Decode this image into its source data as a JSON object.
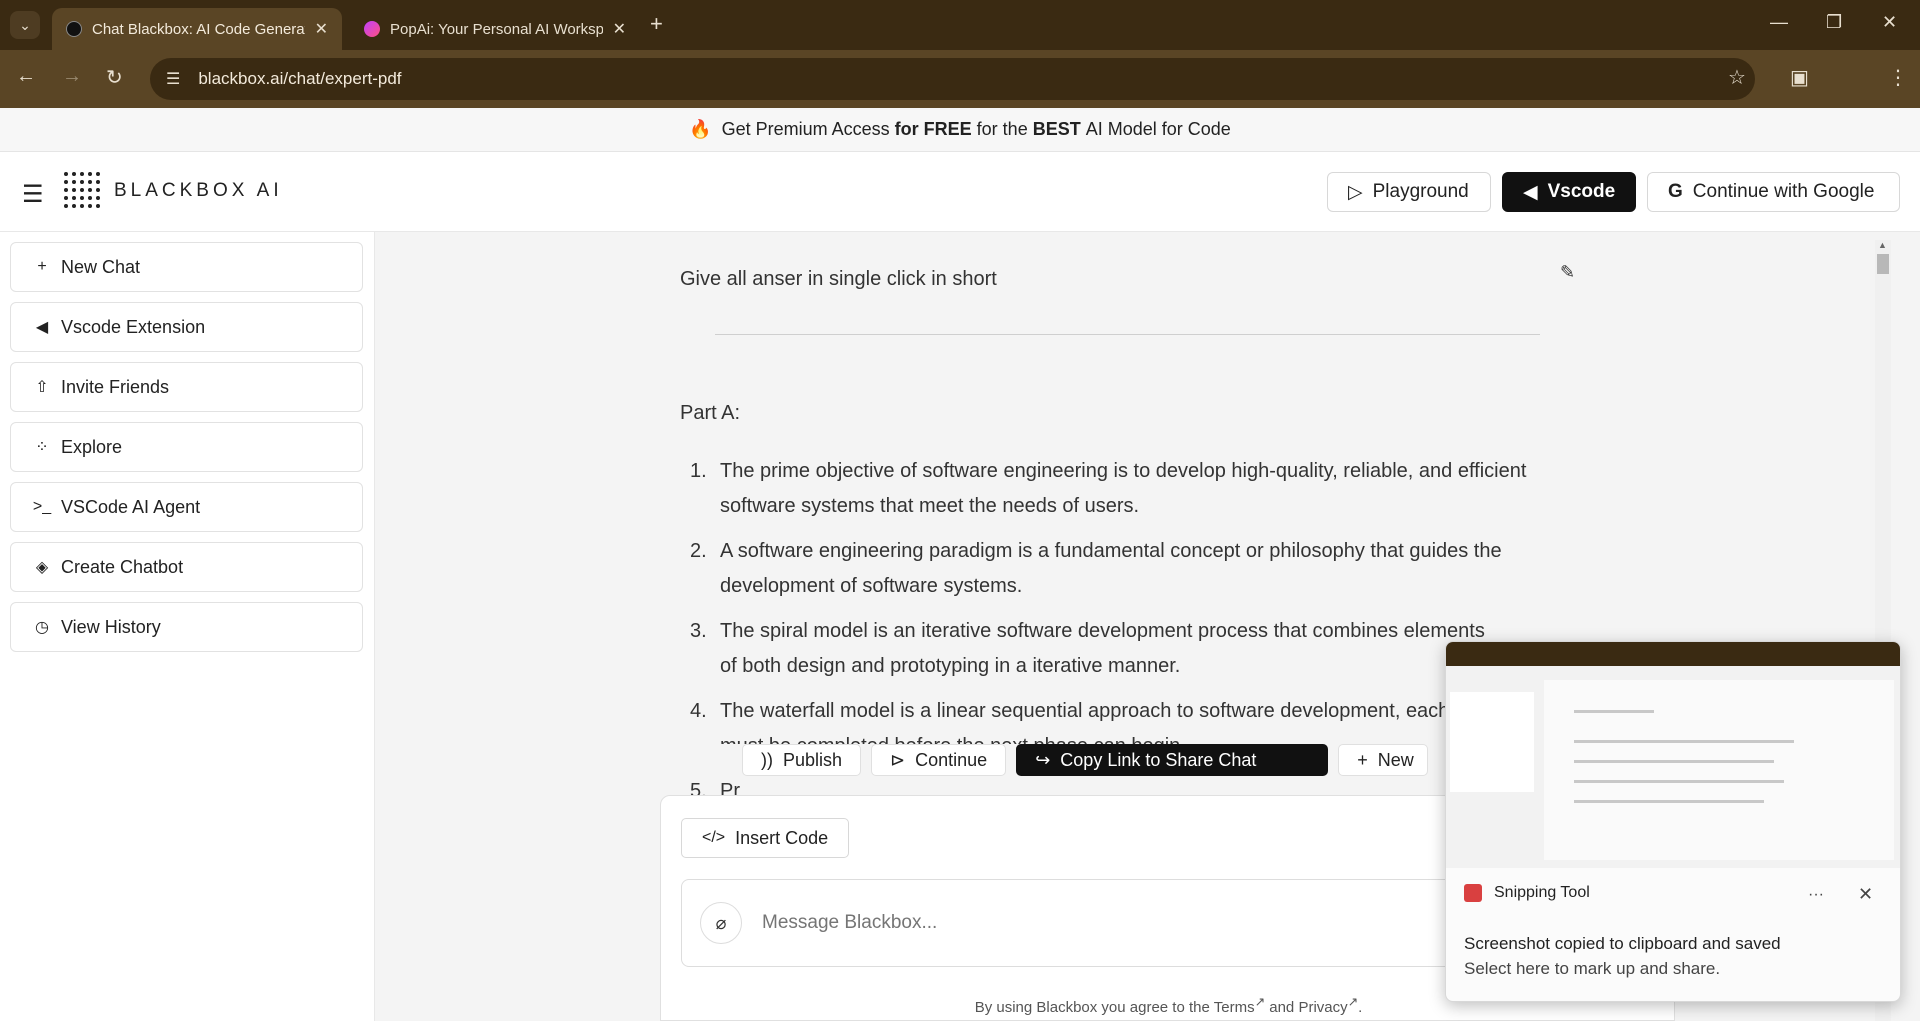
{
  "browser": {
    "tabs": [
      {
        "title": "Chat Blackbox: AI Code Generat",
        "active": true
      },
      {
        "title": "PopAi: Your Personal AI Worksp",
        "active": false
      }
    ],
    "new_tab": "+",
    "url": "blackbox.ai/chat/expert-pdf"
  },
  "promo": {
    "text_1": "Get Premium Access",
    "bold_1": "for FREE",
    "text_2": "for the",
    "bold_2": "BEST",
    "text_3": "AI Model for Code"
  },
  "header": {
    "logo_text": "BLACKBOX AI",
    "playground": "Playground",
    "vscode": "Vscode",
    "google": "Continue with Google"
  },
  "sidebar": {
    "items": [
      {
        "label": "New Chat",
        "icon": "plus-icon"
      },
      {
        "label": "Vscode Extension",
        "icon": "vscode-icon"
      },
      {
        "label": "Invite Friends",
        "icon": "share-icon"
      },
      {
        "label": "Explore",
        "icon": "grid-icon"
      },
      {
        "label": "VSCode AI Agent",
        "icon": "terminal-icon"
      },
      {
        "label": "Create Chatbot",
        "icon": "layers-icon"
      },
      {
        "label": "View History",
        "icon": "clock-icon"
      }
    ]
  },
  "chat": {
    "prompt": "Give all anser in single click in short",
    "part_title": "Part A:",
    "answers": [
      {
        "num": "1.",
        "text": "The prime objective of software engineering is to develop high-quality, reliable, and efficient software systems that meet the needs of users."
      },
      {
        "num": "2.",
        "text": "A software engineering paradigm is a fundamental concept or philosophy that guides the development of software systems."
      },
      {
        "num": "3.",
        "text": "The spiral model is an iterative software development process that combines elements of both design and prototyping in a iterative manner."
      },
      {
        "num": "4.",
        "text": "The waterfall model is a linear sequential approach to software development, each phase must be completed before the next phase can begin."
      },
      {
        "num": "5.",
        "text": "Pr"
      }
    ]
  },
  "actions": {
    "publish": "Publish",
    "continue": "Continue",
    "copy_link": "Copy Link to Share Chat",
    "new": "New"
  },
  "composer": {
    "insert_code": "Insert Code",
    "placeholder": "Message Blackbox...",
    "terms_prefix": "By using Blackbox you agree to the",
    "terms": "Terms",
    "and": "and",
    "privacy": "Privacy"
  },
  "toast": {
    "app": "Snipping Tool",
    "line1": "Screenshot copied to clipboard and saved",
    "line2": "Select here to mark up and share."
  }
}
